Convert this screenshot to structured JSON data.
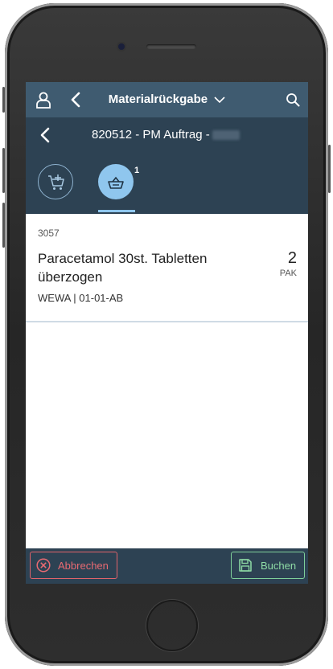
{
  "header": {
    "title": "Materialrückgabe",
    "icons": [
      "user-icon",
      "back-icon",
      "chevron-down-icon",
      "search-icon"
    ]
  },
  "subheader": {
    "title": "820512 - PM Auftrag -"
  },
  "tabs": {
    "basket_badge": "1",
    "icons": [
      "cart-add-icon",
      "basket-icon"
    ]
  },
  "item": {
    "code": "3057",
    "name": "Paracetamol 30st. Tabletten überzogen",
    "quantity": "2",
    "unit": "PAK",
    "location": "WEWA | 01-01-AB"
  },
  "footer": {
    "cancel_label": "Abbrechen",
    "save_label": "Buchen",
    "cancel_color": "#e0636a",
    "save_color": "#7fd09a"
  },
  "colors": {
    "header_bg": "#3f5b70",
    "subheader_bg": "#2d4253",
    "accent": "#8fc6ee"
  }
}
